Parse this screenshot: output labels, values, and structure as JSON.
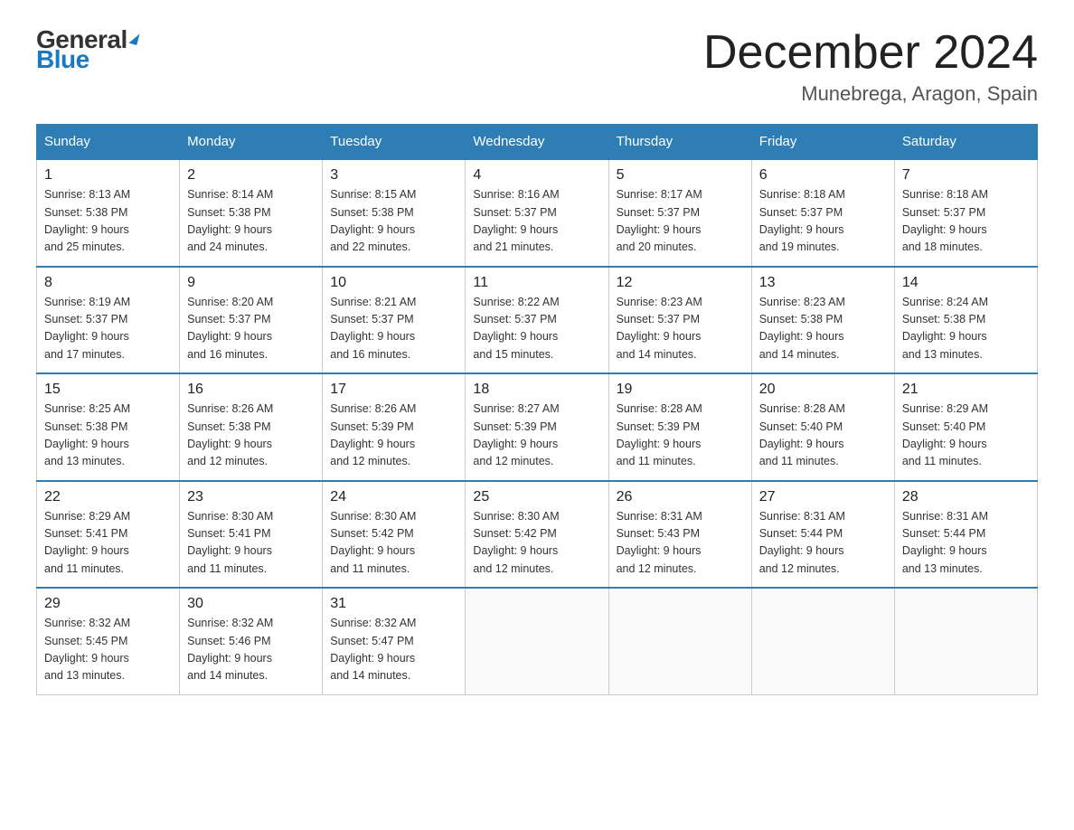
{
  "logo": {
    "general": "General",
    "blue": "Blue"
  },
  "title": "December 2024",
  "location": "Munebrega, Aragon, Spain",
  "days_of_week": [
    "Sunday",
    "Monday",
    "Tuesday",
    "Wednesday",
    "Thursday",
    "Friday",
    "Saturday"
  ],
  "weeks": [
    [
      {
        "num": "1",
        "sunrise": "8:13 AM",
        "sunset": "5:38 PM",
        "daylight": "9 hours and 25 minutes."
      },
      {
        "num": "2",
        "sunrise": "8:14 AM",
        "sunset": "5:38 PM",
        "daylight": "9 hours and 24 minutes."
      },
      {
        "num": "3",
        "sunrise": "8:15 AM",
        "sunset": "5:38 PM",
        "daylight": "9 hours and 22 minutes."
      },
      {
        "num": "4",
        "sunrise": "8:16 AM",
        "sunset": "5:37 PM",
        "daylight": "9 hours and 21 minutes."
      },
      {
        "num": "5",
        "sunrise": "8:17 AM",
        "sunset": "5:37 PM",
        "daylight": "9 hours and 20 minutes."
      },
      {
        "num": "6",
        "sunrise": "8:18 AM",
        "sunset": "5:37 PM",
        "daylight": "9 hours and 19 minutes."
      },
      {
        "num": "7",
        "sunrise": "8:18 AM",
        "sunset": "5:37 PM",
        "daylight": "9 hours and 18 minutes."
      }
    ],
    [
      {
        "num": "8",
        "sunrise": "8:19 AM",
        "sunset": "5:37 PM",
        "daylight": "9 hours and 17 minutes."
      },
      {
        "num": "9",
        "sunrise": "8:20 AM",
        "sunset": "5:37 PM",
        "daylight": "9 hours and 16 minutes."
      },
      {
        "num": "10",
        "sunrise": "8:21 AM",
        "sunset": "5:37 PM",
        "daylight": "9 hours and 16 minutes."
      },
      {
        "num": "11",
        "sunrise": "8:22 AM",
        "sunset": "5:37 PM",
        "daylight": "9 hours and 15 minutes."
      },
      {
        "num": "12",
        "sunrise": "8:23 AM",
        "sunset": "5:37 PM",
        "daylight": "9 hours and 14 minutes."
      },
      {
        "num": "13",
        "sunrise": "8:23 AM",
        "sunset": "5:38 PM",
        "daylight": "9 hours and 14 minutes."
      },
      {
        "num": "14",
        "sunrise": "8:24 AM",
        "sunset": "5:38 PM",
        "daylight": "9 hours and 13 minutes."
      }
    ],
    [
      {
        "num": "15",
        "sunrise": "8:25 AM",
        "sunset": "5:38 PM",
        "daylight": "9 hours and 13 minutes."
      },
      {
        "num": "16",
        "sunrise": "8:26 AM",
        "sunset": "5:38 PM",
        "daylight": "9 hours and 12 minutes."
      },
      {
        "num": "17",
        "sunrise": "8:26 AM",
        "sunset": "5:39 PM",
        "daylight": "9 hours and 12 minutes."
      },
      {
        "num": "18",
        "sunrise": "8:27 AM",
        "sunset": "5:39 PM",
        "daylight": "9 hours and 12 minutes."
      },
      {
        "num": "19",
        "sunrise": "8:28 AM",
        "sunset": "5:39 PM",
        "daylight": "9 hours and 11 minutes."
      },
      {
        "num": "20",
        "sunrise": "8:28 AM",
        "sunset": "5:40 PM",
        "daylight": "9 hours and 11 minutes."
      },
      {
        "num": "21",
        "sunrise": "8:29 AM",
        "sunset": "5:40 PM",
        "daylight": "9 hours and 11 minutes."
      }
    ],
    [
      {
        "num": "22",
        "sunrise": "8:29 AM",
        "sunset": "5:41 PM",
        "daylight": "9 hours and 11 minutes."
      },
      {
        "num": "23",
        "sunrise": "8:30 AM",
        "sunset": "5:41 PM",
        "daylight": "9 hours and 11 minutes."
      },
      {
        "num": "24",
        "sunrise": "8:30 AM",
        "sunset": "5:42 PM",
        "daylight": "9 hours and 11 minutes."
      },
      {
        "num": "25",
        "sunrise": "8:30 AM",
        "sunset": "5:42 PM",
        "daylight": "9 hours and 12 minutes."
      },
      {
        "num": "26",
        "sunrise": "8:31 AM",
        "sunset": "5:43 PM",
        "daylight": "9 hours and 12 minutes."
      },
      {
        "num": "27",
        "sunrise": "8:31 AM",
        "sunset": "5:44 PM",
        "daylight": "9 hours and 12 minutes."
      },
      {
        "num": "28",
        "sunrise": "8:31 AM",
        "sunset": "5:44 PM",
        "daylight": "9 hours and 13 minutes."
      }
    ],
    [
      {
        "num": "29",
        "sunrise": "8:32 AM",
        "sunset": "5:45 PM",
        "daylight": "9 hours and 13 minutes."
      },
      {
        "num": "30",
        "sunrise": "8:32 AM",
        "sunset": "5:46 PM",
        "daylight": "9 hours and 14 minutes."
      },
      {
        "num": "31",
        "sunrise": "8:32 AM",
        "sunset": "5:47 PM",
        "daylight": "9 hours and 14 minutes."
      },
      null,
      null,
      null,
      null
    ]
  ],
  "labels": {
    "sunrise": "Sunrise:",
    "sunset": "Sunset:",
    "daylight": "Daylight:"
  }
}
